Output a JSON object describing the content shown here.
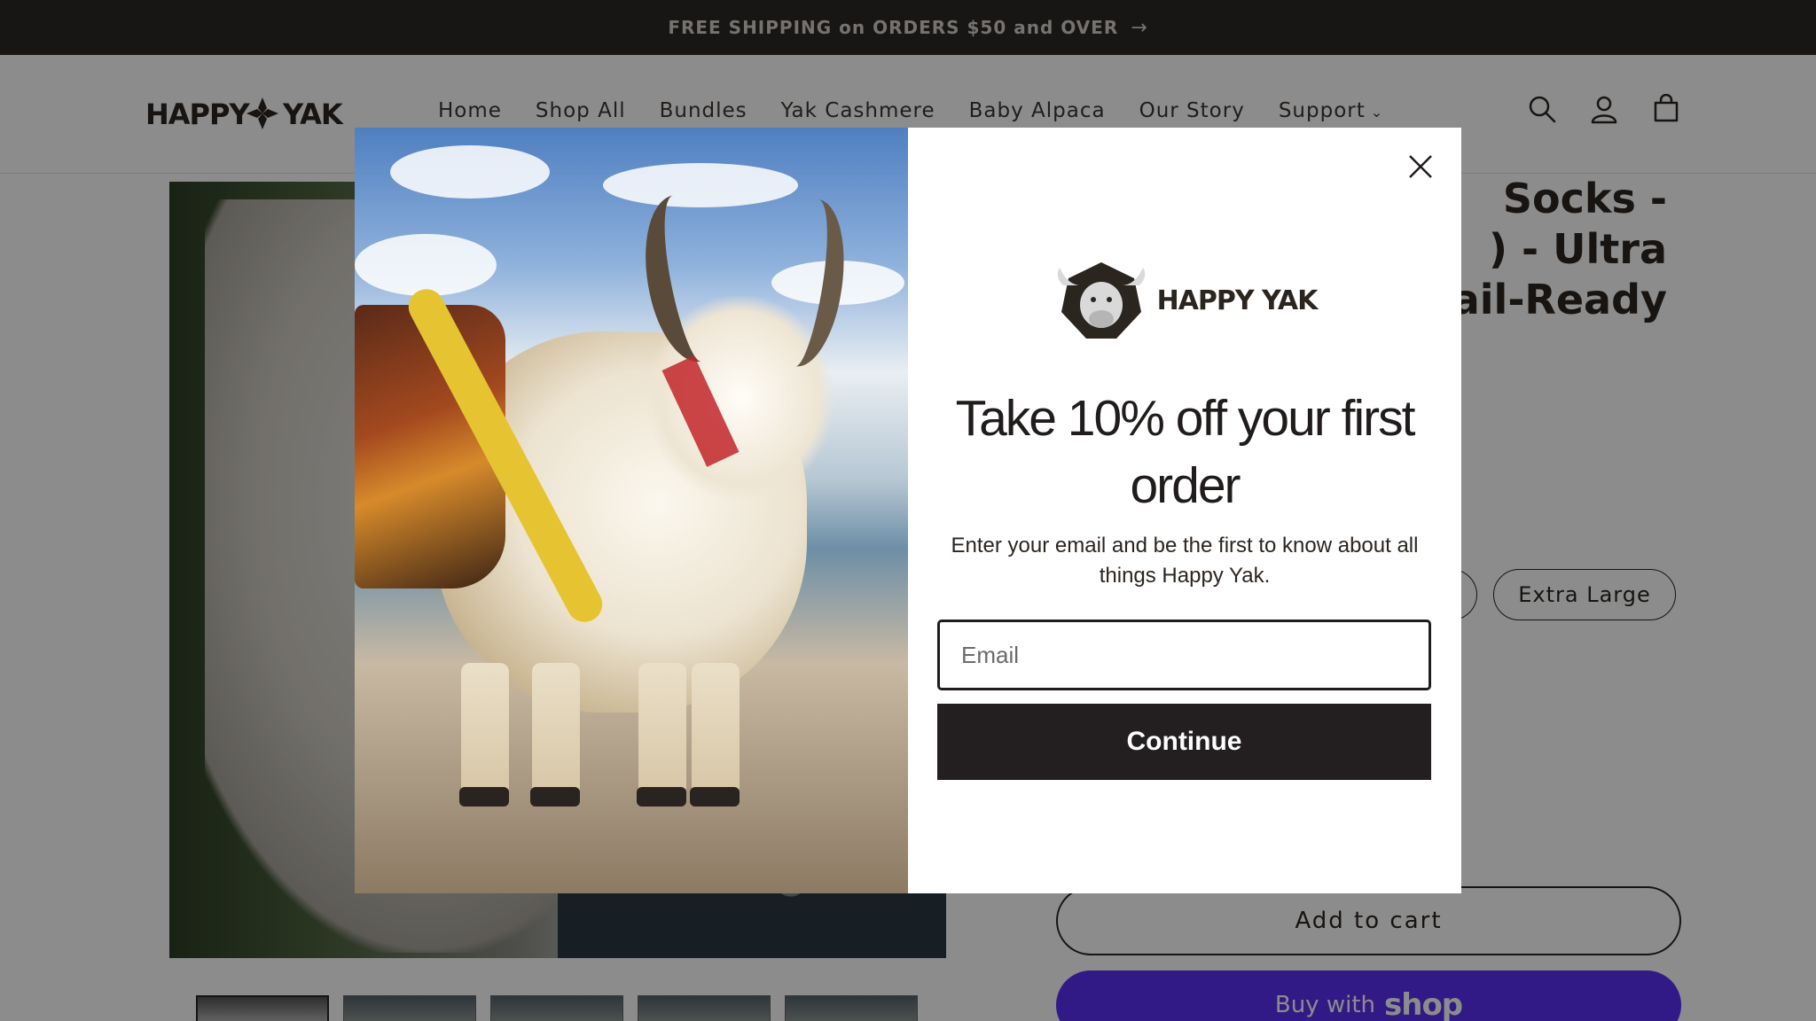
{
  "announcement": {
    "text": "FREE SHIPPING on ORDERS $50 and OVER",
    "arrow_icon": "arrow-right-icon"
  },
  "header": {
    "logo_text": "HAPPY YAK",
    "nav": [
      {
        "label": "Home"
      },
      {
        "label": "Shop All"
      },
      {
        "label": "Bundles"
      },
      {
        "label": "Yak Cashmere"
      },
      {
        "label": "Baby Alpaca"
      },
      {
        "label": "Our Story"
      },
      {
        "label": "Support",
        "has_dropdown": true
      }
    ],
    "icons": [
      "search-icon",
      "account-icon",
      "cart-icon"
    ]
  },
  "product": {
    "title_lines": [
      "Socks -",
      ") - Ultra",
      "ail-Ready"
    ],
    "sizes": [
      {
        "label": ""
      },
      {
        "label": "Extra Large"
      }
    ],
    "add_to_cart": "Add to cart",
    "buy_with": "Buy with",
    "buy_with_brand": "shop"
  },
  "modal": {
    "brand_name": "HAPPY YAK",
    "headline": "Take 10% off your first order",
    "subtext": "Enter your email and be the first to know about all things Happy Yak.",
    "email_placeholder": "Email",
    "continue_label": "Continue",
    "close_icon": "close-icon"
  },
  "colors": {
    "announcement_bg": "#2d2825",
    "button_dark": "#231f20",
    "shop_pay": "#5a31f4"
  }
}
